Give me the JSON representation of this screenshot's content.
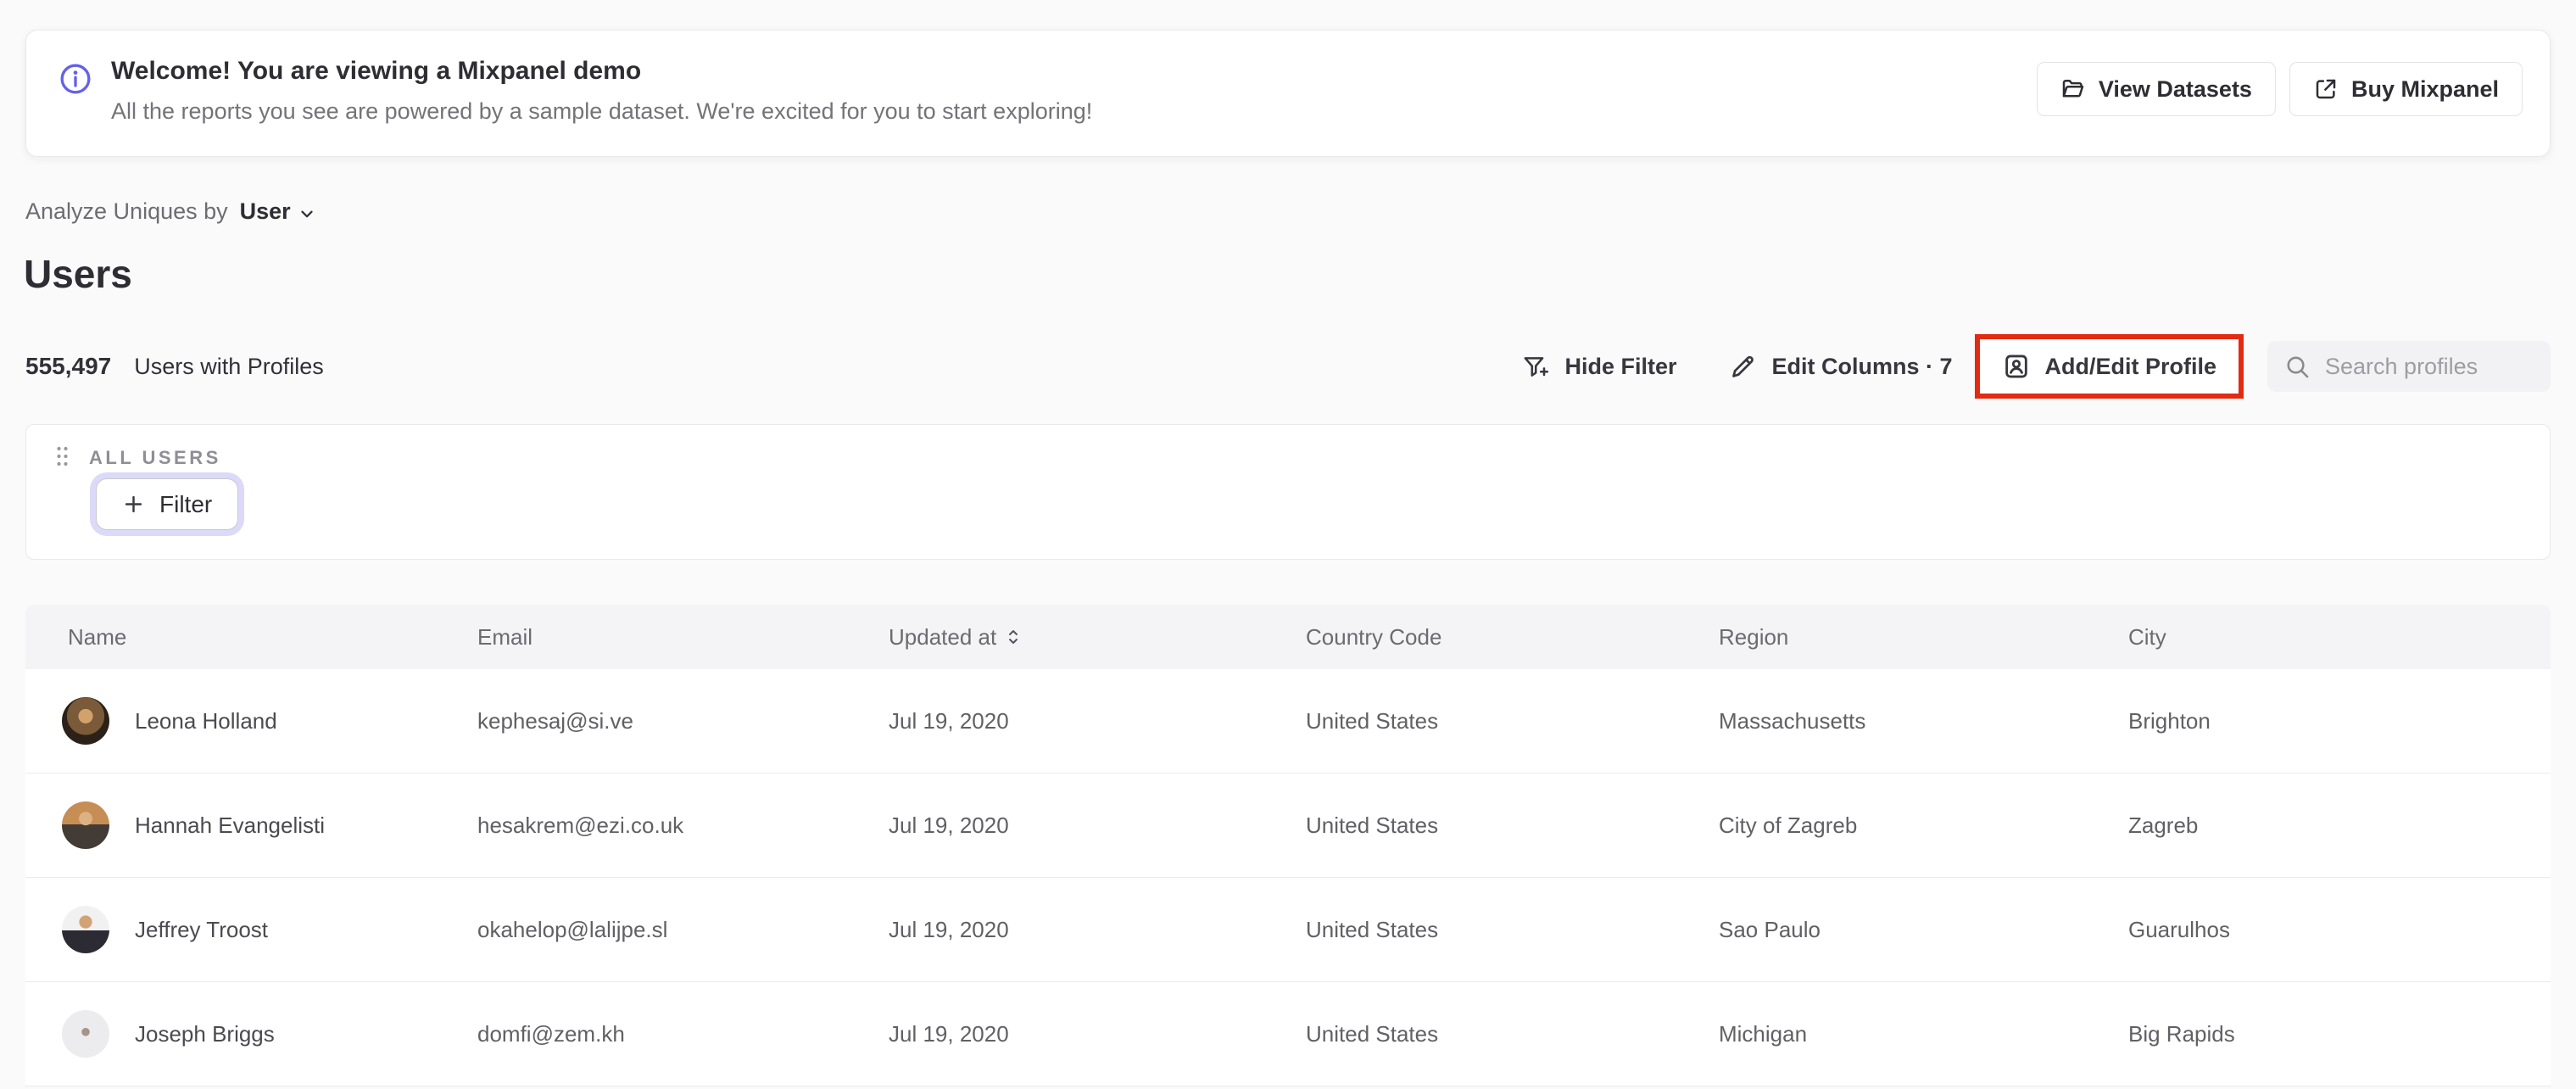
{
  "banner": {
    "title": "Welcome! You are viewing a Mixpanel demo",
    "subtitle": "All the reports you see are powered by a sample dataset. We're excited for you to start exploring!",
    "view_datasets": "View Datasets",
    "buy_mixpanel": "Buy Mixpanel"
  },
  "header": {
    "analyze_label": "Analyze Uniques by",
    "analyze_value": "User",
    "title": "Users",
    "count": "555,497",
    "count_label": "Users with Profiles"
  },
  "toolbar": {
    "hide_filter": "Hide Filter",
    "edit_columns": "Edit Columns · 7",
    "add_edit_profile": "Add/Edit Profile",
    "search_placeholder": "Search profiles"
  },
  "filter_panel": {
    "group_label": "ALL USERS",
    "filter_label": "Filter"
  },
  "table": {
    "columns": [
      "Name",
      "Email",
      "Updated at",
      "Country Code",
      "Region",
      "City"
    ],
    "rows": [
      {
        "name": "Leona Holland",
        "email": "kephesaj@si.ve",
        "updated_at": "Jul 19, 2020",
        "country_code": "United States",
        "region": "Massachusetts",
        "city": "Brighton",
        "avatar": "photo-warm-dark",
        "avatar_style": "background-image:radial-gradient(circle at 50% 40%, #d2a26c 0 19%, #7a5a39 20% 50%, #2b2118 51% 100%)"
      },
      {
        "name": "Hannah Evangelisti",
        "email": "hesakrem@ezi.co.uk",
        "updated_at": "Jul 19, 2020",
        "country_code": "United States",
        "region": "City of Zagreb",
        "city": "Zagreb",
        "avatar": "photo-tan-dark-shirt",
        "avatar_style": "background-image:radial-gradient(circle at 50% 36%, #dcb183 0 17%, rgba(0,0,0,0) 18%), linear-gradient(180deg, #c68e55 0 48%, #433c36 48% 100%)"
      },
      {
        "name": "Jeffrey Troost",
        "email": "okahelop@lalijpe.sl",
        "updated_at": "Jul 19, 2020",
        "country_code": "United States",
        "region": "Sao Paulo",
        "city": "Guarulhos",
        "avatar": "photo-suit-light",
        "avatar_style": "background-image:radial-gradient(circle at 50% 34%, #d2a377 0 16%, rgba(0,0,0,0) 17%), linear-gradient(180deg, #f1f1f1 0 52%, #2c2a33 52% 100%)"
      },
      {
        "name": "Joseph Briggs",
        "email": "domfi@zem.kh",
        "updated_at": "Jul 19, 2020",
        "country_code": "United States",
        "region": "Michigan",
        "city": "Big Rapids",
        "avatar": "photo-light-gray",
        "avatar_style": "background-image:radial-gradient(circle at 50% 46%, #a59488 0 11%, rgba(0,0,0,0) 12%), linear-gradient(#ececee, #ececee)"
      }
    ]
  },
  "colors": {
    "accent_purple": "#6461ea",
    "annotation_red": "#e12b12",
    "search_bg": "#f2f2f4",
    "table_header_bg": "#f4f4f6",
    "filter_ring": "#dcdaf8"
  }
}
